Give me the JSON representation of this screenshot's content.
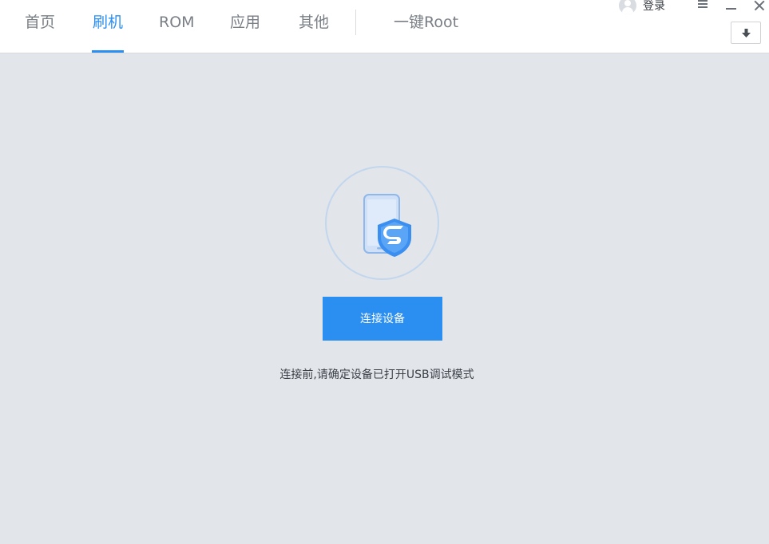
{
  "nav": {
    "tabs": [
      {
        "label": "首页"
      },
      {
        "label": "刷机"
      },
      {
        "label": "ROM"
      },
      {
        "label": "应用"
      },
      {
        "label": "其他"
      }
    ],
    "root_label": "一键Root",
    "active_tab": "刷机"
  },
  "user": {
    "login_label": "登录"
  },
  "main": {
    "connect_button_label": "连接设备",
    "hint_text": "连接前,请确定设备已打开USB调试模式"
  },
  "colors": {
    "accent": "#2a8ff0",
    "background": "#e2e5ea"
  },
  "icons": {
    "avatar": "user-avatar-icon",
    "menu": "menu-icon",
    "minimize": "minimize-icon",
    "close": "close-icon",
    "download": "download-icon",
    "device": "phone-shield-icon"
  }
}
